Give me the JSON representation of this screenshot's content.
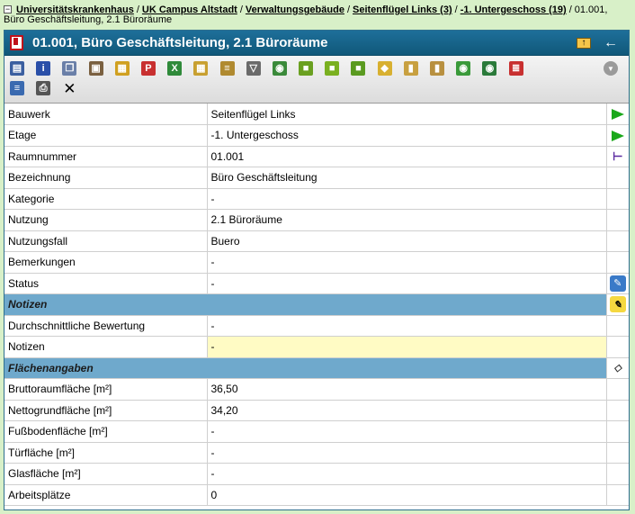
{
  "breadcrumb": {
    "toggle": "−",
    "items": [
      "Universitätskrankenhaus",
      "UK Campus Altstadt",
      "Verwaltungsgebäude",
      "Seitenflügel Links (3)",
      "-1. Untergeschoss (19)"
    ],
    "current": "01.001, Büro Geschäftsleitung, 2.1 Büroräume",
    "separator": "/"
  },
  "window": {
    "title": "01.001, Büro Geschäftsleitung, 2.1 Büroräume",
    "up_icon": "↑",
    "back_icon": "←"
  },
  "toolbar": {
    "row1": [
      {
        "icon": "properties-icon",
        "glyph": "▤",
        "color": "#3b5fa0"
      },
      {
        "icon": "info-icon",
        "glyph": "i",
        "color": "#2a4fa8"
      },
      {
        "icon": "copy-icon",
        "glyph": "❐",
        "color": "#6a7fa8"
      },
      {
        "icon": "clipboard-icon",
        "glyph": "▣",
        "color": "#7a6040"
      },
      {
        "icon": "grid-icon",
        "glyph": "▦",
        "color": "#d0a020"
      },
      {
        "icon": "pdf-icon",
        "glyph": "P",
        "color": "#c83030"
      },
      {
        "icon": "excel-icon",
        "glyph": "X",
        "color": "#2f8a3a"
      },
      {
        "icon": "table-icon",
        "glyph": "▦",
        "color": "#c8a030"
      },
      {
        "icon": "list-icon",
        "glyph": "≡",
        "color": "#b08a30"
      },
      {
        "icon": "filter-icon",
        "glyph": "▽",
        "color": "#6a6a6a"
      },
      {
        "icon": "globe-icon",
        "glyph": "◉",
        "color": "#3a8a3a"
      },
      {
        "icon": "green-box-icon",
        "glyph": "■",
        "color": "#6aa020"
      },
      {
        "icon": "green-box-2-icon",
        "glyph": "■",
        "color": "#7ab020"
      },
      {
        "icon": "green-box-3-icon",
        "glyph": "■",
        "color": "#5a9a20"
      },
      {
        "icon": "cube-icon",
        "glyph": "◆",
        "color": "#d8b030"
      },
      {
        "icon": "bars-icon",
        "glyph": "▮",
        "color": "#c8a040"
      },
      {
        "icon": "chart-icon",
        "glyph": "▮",
        "color": "#b89040"
      },
      {
        "icon": "globe-green-icon",
        "glyph": "◉",
        "color": "#3a9a3a"
      },
      {
        "icon": "globe-dark-icon",
        "glyph": "◉",
        "color": "#2a7a3a"
      },
      {
        "icon": "list-red-icon",
        "glyph": "≣",
        "color": "#c83030"
      }
    ],
    "row2": [
      {
        "icon": "report-icon",
        "glyph": "≡",
        "color": "#3a6ab0"
      },
      {
        "icon": "print-icon",
        "glyph": "⎙",
        "color": "#555555"
      }
    ],
    "close_glyph": "✕",
    "down_glyph": "▼"
  },
  "rows": [
    {
      "label": "Bauwerk",
      "value": "Seitenflügel Links",
      "action": "go-arrow-icon",
      "type": "normal"
    },
    {
      "label": "Etage",
      "value": "-1. Untergeschoss",
      "action": "go-arrow-icon",
      "type": "normal"
    },
    {
      "label": "Raumnummer",
      "value": "01.001",
      "action": "tree-icon",
      "type": "normal"
    },
    {
      "label": "Bezeichnung",
      "value": "Büro Geschäftsleitung",
      "action": "",
      "type": "normal"
    },
    {
      "label": "Kategorie",
      "value": "-",
      "action": "",
      "type": "normal"
    },
    {
      "label": "Nutzung",
      "value": "2.1 Büroräume",
      "action": "",
      "type": "normal"
    },
    {
      "label": "Nutzungsfall",
      "value": "Buero",
      "action": "",
      "type": "normal"
    },
    {
      "label": "Bemerkungen",
      "value": "-",
      "action": "",
      "type": "normal"
    },
    {
      "label": "Status",
      "value": "-",
      "action": "status-edit-icon",
      "type": "normal"
    },
    {
      "label": "Notizen",
      "value": "",
      "action": "note-edit-icon",
      "type": "section"
    },
    {
      "label": "Durchschnittliche Bewertung",
      "value": "-",
      "action": "",
      "type": "normal"
    },
    {
      "label": "Notizen",
      "value": "-",
      "action": "",
      "type": "yellow"
    },
    {
      "label": "Flächenangaben",
      "value": "",
      "action": "area-icon",
      "type": "section"
    },
    {
      "label": "Bruttoraumfläche [m²]",
      "value": "36,50",
      "action": "",
      "type": "normal"
    },
    {
      "label": "Nettogrundfläche [m²]",
      "value": "34,20",
      "action": "",
      "type": "normal"
    },
    {
      "label": "Fußbodenfläche [m²]",
      "value": "-",
      "action": "",
      "type": "normal"
    },
    {
      "label": "Türfläche [m²]",
      "value": "-",
      "action": "",
      "type": "normal"
    },
    {
      "label": "Glasfläche [m²]",
      "value": "-",
      "action": "",
      "type": "normal"
    },
    {
      "label": "Arbeitsplätze",
      "value": "0",
      "action": "",
      "type": "normal"
    }
  ],
  "colors": {
    "background": "#d8f0c8",
    "titlebar": "#1e6f9a",
    "section": "#6fa9cc",
    "notes_highlight": "#fffbc4",
    "go_arrow": "#1aa81a"
  }
}
